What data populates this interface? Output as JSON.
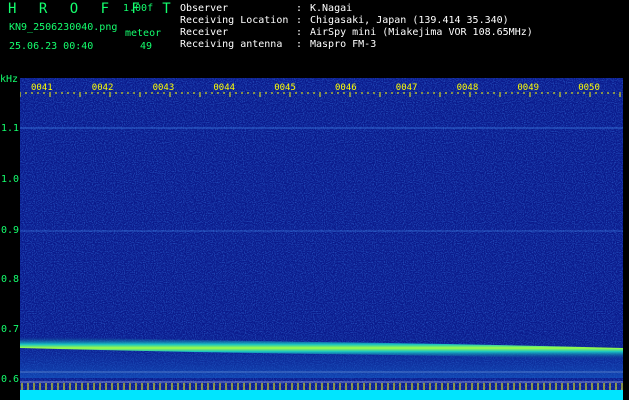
{
  "header": {
    "app_name": "H R O F F T",
    "version": "1.00f",
    "filename": "KN9_2506230040.png",
    "meteor_label": "meteor",
    "datetime": "25.06.23 00:40",
    "count": "49"
  },
  "info": {
    "rows": [
      {
        "key": "Observer",
        "value": "K.Nagai"
      },
      {
        "key": "Receiving Location",
        "value": "Chigasaki, Japan (139.414 35.340)"
      },
      {
        "key": "Receiver",
        "value": "AirSpy mini (Miakejima VOR 108.65MHz)"
      },
      {
        "key": "Receiving antenna",
        "value": "Maspro FM-3"
      }
    ],
    "separator": ":"
  },
  "axis": {
    "unit": "kHz",
    "y_labels": [
      "1.1",
      "1.0",
      "0.9",
      "0.8",
      "0.7",
      "0.6"
    ],
    "x_labels": [
      "0041",
      "0042",
      "0043",
      "0044",
      "0045",
      "0046",
      "0047",
      "0048",
      "0049",
      "0050"
    ]
  },
  "colors": {
    "background": "#000000",
    "spectrum_bg": "#0a1a8c",
    "label_green": "#14ff6e",
    "tick_yellow": "#ffff00",
    "trace_green": "#a0ff40",
    "baseline_cyan": "#00e5ff"
  }
}
